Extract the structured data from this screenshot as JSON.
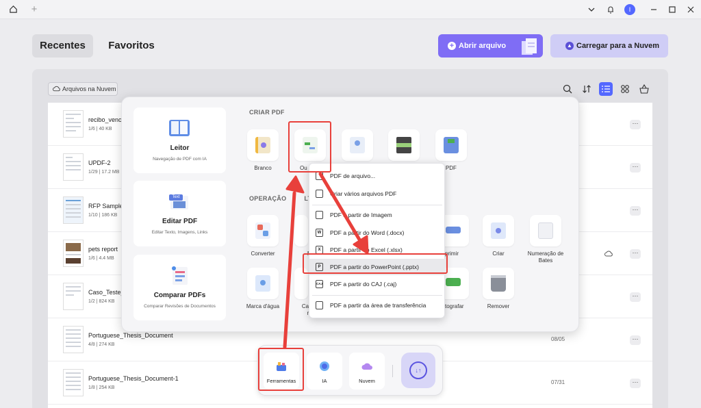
{
  "titlebar": {
    "home_icon": "home-icon",
    "new_tab": "+",
    "avatar_letter": "I"
  },
  "tabs": [
    {
      "label": "Recentes",
      "active": true
    },
    {
      "label": "Favoritos",
      "active": false
    }
  ],
  "actions": {
    "open_file": "Abrir arquivo",
    "upload_cloud": "Carregar para a Nuvem"
  },
  "cloud_chip": "Arquivos na Nuvem",
  "files": [
    {
      "name": "recibo_venci",
      "meta": "1/6 | 40 KB",
      "date": ""
    },
    {
      "name": "UPDF-2",
      "meta": "1/29 | 17.2 MB",
      "date": ""
    },
    {
      "name": "RFP Sample",
      "meta": "1/10 | 186 KB",
      "date": ""
    },
    {
      "name": "pets report",
      "meta": "1/6 | 4.4 MB",
      "date": ""
    },
    {
      "name": "Caso_Teste_U",
      "meta": "1/2 | 824 KB",
      "date": ""
    },
    {
      "name": "Portuguese_Thesis_Document",
      "meta": "4/8 | 274 KB",
      "date": "08/05"
    },
    {
      "name": "Portuguese_Thesis_Document-1",
      "meta": "1/8 | 254 KB",
      "date": "07/31"
    }
  ],
  "more_label": "···",
  "popup": {
    "cards": [
      {
        "title": "Leitor",
        "subtitle": "Navegação de PDF com IA"
      },
      {
        "title": "Editar PDF",
        "subtitle": "Editar Texto, Imagens, Links",
        "badge": "Text"
      },
      {
        "title": "Comparar PDFs",
        "subtitle": "Comparar Revisões de Documentos"
      }
    ],
    "create_section": "CRIAR PDF",
    "create_tiles": [
      "Branco",
      "Ou",
      "",
      "",
      "fólio PDF"
    ],
    "ops_section": "OPERAÇÃO",
    "ops_suffix": "LTI-",
    "ops_row1": [
      "Converter",
      "Me",
      "",
      "",
      "primir",
      "Criar",
      "Numeração de Bates"
    ],
    "ops_row2": [
      "Marca d'água",
      "Cabe rod",
      "",
      "",
      "tografar",
      "Remover"
    ]
  },
  "menu": {
    "items": [
      {
        "label": "PDF de arquivo...",
        "icon": "file-icon"
      },
      {
        "label": "Criar vários arquivos PDF",
        "icon": "files-icon"
      },
      {
        "label": "PDF a partir de Imagem",
        "icon": "image-icon"
      },
      {
        "label": "PDF a partir do Word (.docx)",
        "icon": "word-icon",
        "glyph": "W"
      },
      {
        "label": "PDF a partir do Excel (.xlsx)",
        "icon": "excel-icon",
        "glyph": "X"
      },
      {
        "label": "PDF a partir do PowerPoint (.pptx)",
        "icon": "powerpoint-icon",
        "glyph": "P"
      },
      {
        "label": "PDF a partir do CAJ (.caj)",
        "icon": "caj-icon",
        "glyph": "CAJ"
      },
      {
        "label": "PDF a partir da área de transferência",
        "icon": "clipboard-icon"
      }
    ]
  },
  "dock": {
    "items": [
      {
        "label": "Ferramentas"
      },
      {
        "label": "IA"
      },
      {
        "label": "Nuvem"
      }
    ]
  },
  "colors": {
    "accent": "#5468ff",
    "open_button": "#7f6df5",
    "cloud_button": "#cfcdf6",
    "annotation_red": "#e8403b"
  }
}
